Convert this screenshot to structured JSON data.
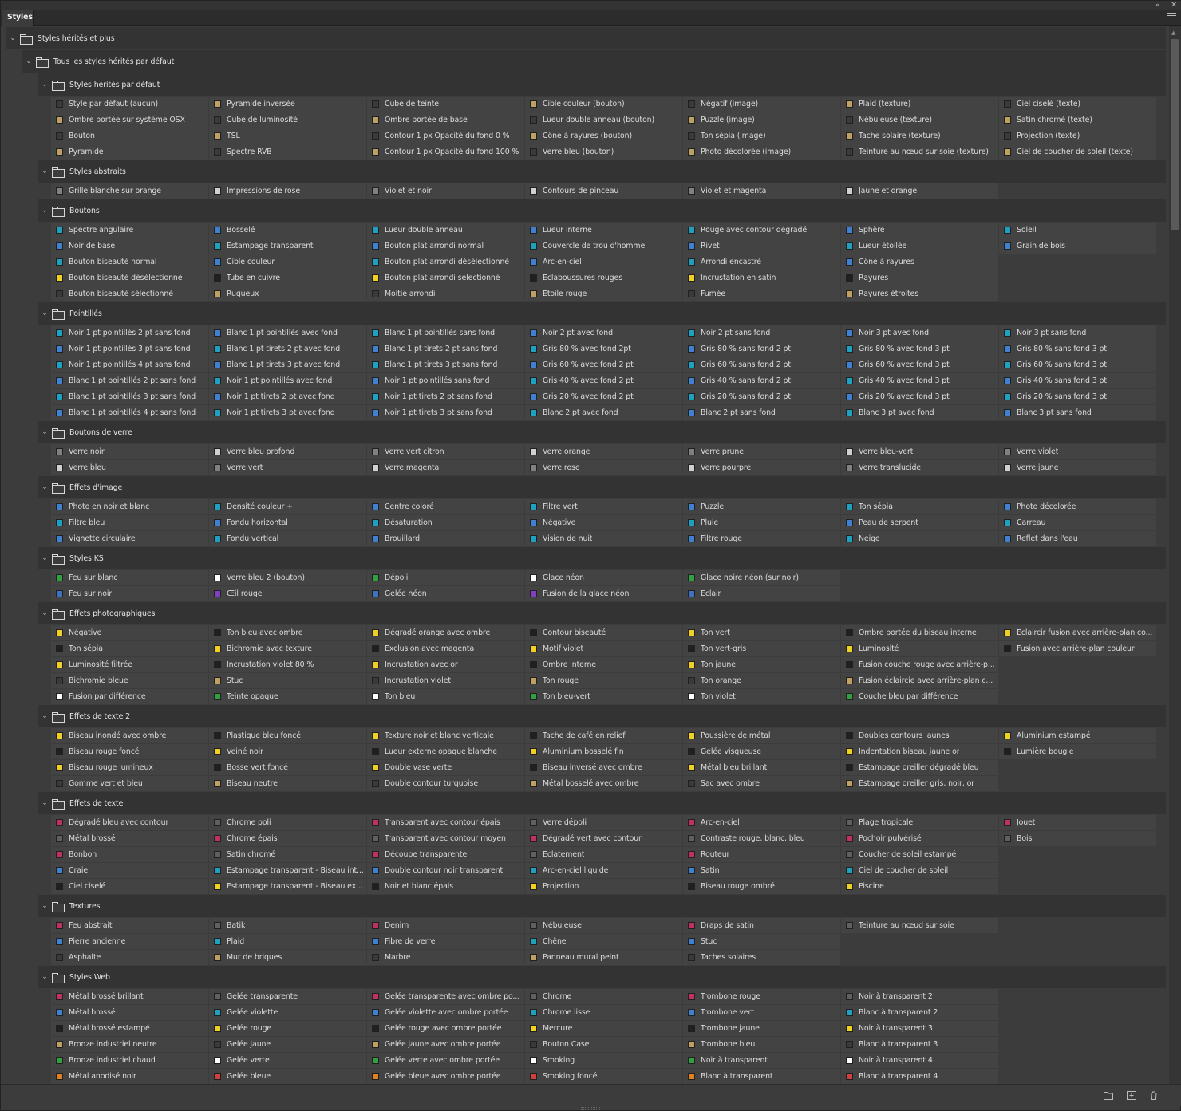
{
  "panel": {
    "tab": "Styles"
  },
  "groups": [
    {
      "label": "Styles hérités et plus",
      "level": 0,
      "items": []
    },
    {
      "label": "Tous les styles hérités par défaut",
      "level": 1,
      "items": []
    },
    {
      "label": "Styles hérités par défaut",
      "level": 2,
      "items": [
        "Style par défaut (aucun)",
        "Pyramide inversée",
        "Cube de teinte",
        "Cible couleur (bouton)",
        "Négatif (image)",
        "Plaid (texture)",
        "Ciel ciselé (texte)",
        "Ombre portée sur système OSX",
        "Cube de luminosité",
        "Ombre portée de base",
        "Lueur double anneau (bouton)",
        "Puzzle (image)",
        "Nébuleuse (texture)",
        "Satin chromé (texte)",
        "Bouton",
        "TSL",
        "Contour 1 px Opacité du fond 0 %",
        "Cône à rayures (bouton)",
        "Ton sépia (image)",
        "Tache solaire (texture)",
        "Projection (texte)",
        "Pyramide",
        "Spectre RVB",
        "Contour 1 px Opacité du fond 100 %",
        "Verre bleu (bouton)",
        "Photo décolorée (image)",
        "Teinture au nœud sur soie (texture)",
        "Ciel de coucher de soleil (texte)"
      ]
    },
    {
      "label": "Styles abstraits",
      "level": 2,
      "items": [
        "Grille blanche sur orange",
        "Impressions de rose",
        "Violet et noir",
        "Contours de pinceau",
        "Violet et magenta",
        "Jaune et orange"
      ]
    },
    {
      "label": "Boutons",
      "level": 2,
      "items": [
        "Spectre angulaire",
        "Bosselé",
        "Lueur double anneau",
        "Lueur interne",
        "Rouge avec contour dégradé",
        "Sphère",
        "Soleil",
        "Noir de base",
        "Estampage transparent",
        "Bouton plat arrondi normal",
        "Couvercle de trou d'homme",
        "Rivet",
        "Lueur étoilée",
        "Grain de bois",
        "Bouton biseauté normal",
        "Cible couleur",
        "Bouton plat arrondi désélectionné",
        "Arc-en-ciel",
        "Arrondi encastré",
        "Cône à rayures",
        "",
        "Bouton biseauté désélectionné",
        "Tube en cuivre",
        "Bouton plat arrondi sélectionné",
        "Eclaboussures rouges",
        "Incrustation en satin",
        "Rayures",
        "",
        "Bouton biseauté sélectionné",
        "Rugueux",
        "Moitié arrondi",
        "Etoile rouge",
        "Fumée",
        "Rayures étroites",
        ""
      ]
    },
    {
      "label": "Pointillés",
      "level": 2,
      "items": [
        "Noir 1 pt pointillés 2 pt sans fond",
        "Blanc 1 pt pointillés avec fond",
        "Blanc 1 pt pointillés sans fond",
        "Noir 2 pt avec fond",
        "Noir 2 pt sans fond",
        "Noir 3 pt avec fond",
        "Noir 3 pt sans fond",
        "Noir 1 pt pointillés 3 pt sans fond",
        "Blanc 1 pt tirets 2 pt avec fond",
        "Blanc 1 pt tirets 2 pt sans fond",
        "Gris 80 % avec fond 2pt",
        "Gris 80 % sans fond 2 pt",
        "Gris 80 % avec fond 3 pt",
        "Gris 80 % sans fond 3 pt",
        "Noir 1 pt pointillés 4 pt sans fond",
        "Blanc 1 pt tirets 3 pt avec fond",
        "Blanc 1 pt tirets 3 pt sans fond",
        "Gris 60 % avec fond 2 pt",
        "Gris 60 % sans fond 2 pt",
        "Gris 60 % avec fond 3 pt",
        "Gris 60 % sans fond 3 pt",
        "Blanc 1 pt pointillés 2 pt sans fond",
        "Noir 1 pt pointillés avec fond",
        "Noir 1 pt pointillés sans fond",
        "Gris 40 % avec fond 2 pt",
        "Gris 40 % sans fond 2 pt",
        "Gris 40 % avec fond 3 pt",
        "Gris 40 % sans fond 3 pt",
        "Blanc 1 pt pointillés 3 pt sans fond",
        "Noir 1 pt tirets 2 pt avec fond",
        "Noir 1 pt tirets 2 pt sans fond",
        "Gris 20 % avec fond 2 pt",
        "Gris 20 % sans fond 2 pt",
        "Gris 20 % avec fond 3 pt",
        "Gris 20 % sans fond 3 pt",
        "Blanc 1 pt pointillés 4 pt sans fond",
        "Noir 1 pt tirets 3 pt avec fond",
        "Noir 1 pt tirets 3 pt sans fond",
        "Blanc 2 pt avec fond",
        "Blanc 2 pt sans fond",
        "Blanc 3 pt avec fond",
        "Blanc 3 pt sans fond"
      ]
    },
    {
      "label": "Boutons de verre",
      "level": 2,
      "items": [
        "Verre noir",
        "Verre bleu profond",
        "Verre vert citron",
        "Verre orange",
        "Verre prune",
        "Verre bleu-vert",
        "Verre violet",
        "Verre bleu",
        "Verre vert",
        "Verre magenta",
        "Verre rose",
        "Verre pourpre",
        "Verre translucide",
        "Verre jaune"
      ]
    },
    {
      "label": "Effets d'image",
      "level": 2,
      "items": [
        "Photo en noir et blanc",
        "Densité couleur +",
        "Centre coloré",
        "Filtre vert",
        "Puzzle",
        "Ton sépia",
        "Photo décolorée",
        "Filtre bleu",
        "Fondu horizontal",
        "Désaturation",
        "Négative",
        "Pluie",
        "Peau de serpent",
        "Carreau",
        "Vignette circulaire",
        "Fondu vertical",
        "Brouillard",
        "Vision de nuit",
        "Filtre rouge",
        "Neige",
        "Reflet dans l'eau"
      ]
    },
    {
      "label": "Styles KS",
      "level": 2,
      "items": [
        "Feu sur blanc",
        "Verre bleu 2 (bouton)",
        "Dépoli",
        "Glace néon",
        "Glace noire néon (sur noir)",
        "",
        "",
        "Feu sur noir",
        "Œil rouge",
        "Gelée néon",
        "Fusion de la glace néon",
        "Eclair",
        "",
        ""
      ]
    },
    {
      "label": "Effets photographiques",
      "level": 2,
      "items": [
        "Négative",
        "Ton bleu avec ombre",
        "Dégradé orange avec ombre",
        "Contour biseauté",
        "Ton vert",
        "Ombre portée du biseau interne",
        "Eclaircir fusion avec arrière-plan co...",
        "Ton sépia",
        "Bichromie avec texture",
        "Exclusion avec magenta",
        "Motif violet",
        "Ton vert-gris",
        "Luminosité",
        "Fusion avec arrière-plan couleur",
        "Luminosité filtrée",
        "Incrustation violet 80 %",
        "Incrustation avec or",
        "Ombre interne",
        "Ton jaune",
        "Fusion couche rouge avec arrière-p...",
        "",
        "Bichromie bleue",
        "Stuc",
        "Incrustation violet",
        "Ton rouge",
        "Ton orange",
        "Fusion éclaircie avec arrière-plan c...",
        "",
        "Fusion par différence",
        "Teinte opaque",
        "Ton bleu",
        "Ton bleu-vert",
        "Ton violet",
        "Couche bleu par différence",
        ""
      ]
    },
    {
      "label": "Effets de texte 2",
      "level": 2,
      "items": [
        "Biseau inondé avec ombre",
        "Plastique bleu foncé",
        "Texture noir et blanc verticale",
        "Tache de café en relief",
        "Poussière de métal",
        "Doubles contours jaunes",
        "Aluminium estampé",
        "Biseau rouge foncé",
        "Veiné noir",
        "Lueur externe opaque blanche",
        "Aluminium bosselé fin",
        "Gelée visqueuse",
        "Indentation biseau jaune or",
        "Lumière bougie",
        "Biseau rouge lumineux",
        "Bosse vert foncé",
        "Double vase verte",
        "Biseau inversé avec ombre",
        "Métal bleu brillant",
        "Estampage oreiller dégradé bleu",
        "",
        "Gomme vert et bleu",
        "Biseau neutre",
        "Double contour turquoise",
        "Métal bosselé avec ombre",
        "Sac avec ombre",
        "Estampage oreiller gris, noir, or",
        ""
      ]
    },
    {
      "label": "Effets de texte",
      "level": 2,
      "items": [
        "Dégradé bleu avec contour",
        "Chrome poli",
        "Transparent avec contour épais",
        "Verre dépoli",
        "Arc-en-ciel",
        "Plage tropicale",
        "Jouet",
        "Métal brossé",
        "Chrome épais",
        "Transparent avec contour moyen",
        "Dégradé vert avec contour",
        "Contraste rouge, blanc, bleu",
        "Pochoir pulvérisé",
        "Bois",
        "Bonbon",
        "Satin chromé",
        "Découpe transparente",
        "Eclatement",
        "Routeur",
        "Coucher de soleil estampé",
        "",
        "Craie",
        "Estampage transparent - Biseau int...",
        "Double contour noir transparent",
        "Arc-en-ciel liquide",
        "Satin",
        "Ciel de coucher de soleil",
        "",
        "Ciel ciselé",
        "Estampage transparent - Biseau ex...",
        "Noir et blanc épais",
        "Projection",
        "Biseau rouge ombré",
        "Piscine",
        ""
      ]
    },
    {
      "label": "Textures",
      "level": 2,
      "items": [
        "Feu abstrait",
        "Batik",
        "Denim",
        "Nébuleuse",
        "Draps de satin",
        "Teinture au nœud sur soie",
        "",
        "Pierre ancienne",
        "Plaid",
        "Fibre de verre",
        "Chêne",
        "Stuc",
        "",
        "",
        "Asphalte",
        "Mur de briques",
        "Marbre",
        "Panneau mural peint",
        "Taches solaires",
        "",
        ""
      ]
    },
    {
      "label": "Styles Web",
      "level": 2,
      "items": [
        "Métal brossé brillant",
        "Gelée transparente",
        "Gelée transparente avec ombre po...",
        "Chrome",
        "Trombone rouge",
        "Noir à transparent 2",
        "",
        "Métal brossé",
        "Gelée violette",
        "Gelée violette avec ombre portée",
        "Chrome lisse",
        "Trombone vert",
        "Blanc à transparent 2",
        "",
        "Métal brossé estampé",
        "Gelée rouge",
        "Gelée rouge avec ombre portée",
        "Mercure",
        "Trombone jaune",
        "Noir à transparent 3",
        "",
        "Bronze industriel neutre",
        "Gelée jaune",
        "Gelée jaune avec ombre portée",
        "Bouton Case",
        "Trombone bleu",
        "Blanc à transparent 3",
        "",
        "Bronze industriel chaud",
        "Gelée verte",
        "Gelée verte avec ombre portée",
        "Smoking",
        "Noir à transparent",
        "Noir à transparent 4",
        "",
        "Métal anodisé noir",
        "Gelée bleue",
        "Gelée bleue avec ombre portée",
        "Smoking foncé",
        "Blanc à transparent",
        "Blanc à transparent 4",
        ""
      ]
    }
  ],
  "swatch_palette": [
    "#3a3a3a",
    "#ffffff",
    "#d04040",
    "#4070c0",
    "#808080",
    "#c03060",
    "#4080d0",
    "#202020",
    "#c0a060",
    "#30a040",
    "#e08020",
    "#8040c0",
    "#d0d0d0",
    "#606060",
    "#20a0c0",
    "#f0d020"
  ],
  "footer": {
    "icons": [
      "new-group-icon",
      "new-style-icon",
      "delete-icon"
    ]
  }
}
